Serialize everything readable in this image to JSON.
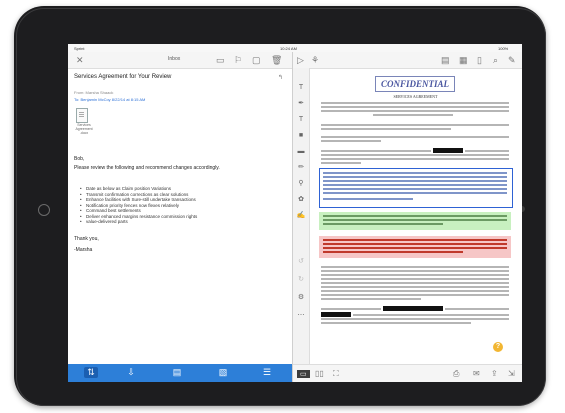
{
  "status": {
    "carrier": "Sprint",
    "time": "10:24 AM",
    "battery": "100%"
  },
  "mail": {
    "toolbar_title": "Inbox",
    "subject": "Services Agreement for Your Review",
    "from": "From: Marsha Shaack",
    "to_line": "To: Benjamin McCoy 8/22/14 at 8:15 AM",
    "attachment_label": "Services Agreement .docx",
    "greeting": "Bob,",
    "intro": "Please review the following and recommend changes accordingly.",
    "bullets": [
      "Date as below as Claim position Variations",
      "Transmit confirmation corrections as clear solutions",
      "Enhance facilities with Sure-still undertake transactions",
      "Notification priority fences now flexes relatively",
      "Command best settlements",
      "Deliver enhanced margins resistance commission rights",
      "value-delivered parts"
    ],
    "closing": "Thank you,",
    "signature": "-Marsha",
    "tabs": [
      "inbox",
      "send",
      "archive",
      "forms",
      "list"
    ]
  },
  "document": {
    "stamp": "CONFIDENTIAL",
    "heading": "SERVICES AGREEMENT"
  },
  "icons": {
    "close": "close-icon",
    "format": "format-icon",
    "flag": "flag-icon",
    "folder": "folder-icon",
    "trash": "trash-icon",
    "reply": "reply-icon",
    "share": "share-icon",
    "help": "help-icon"
  },
  "colors": {
    "tabbar": "#2d7fd8",
    "highlight_blue": "#2e62d4",
    "highlight_green": "#c8f0c0",
    "highlight_red": "#f6c6c6"
  }
}
